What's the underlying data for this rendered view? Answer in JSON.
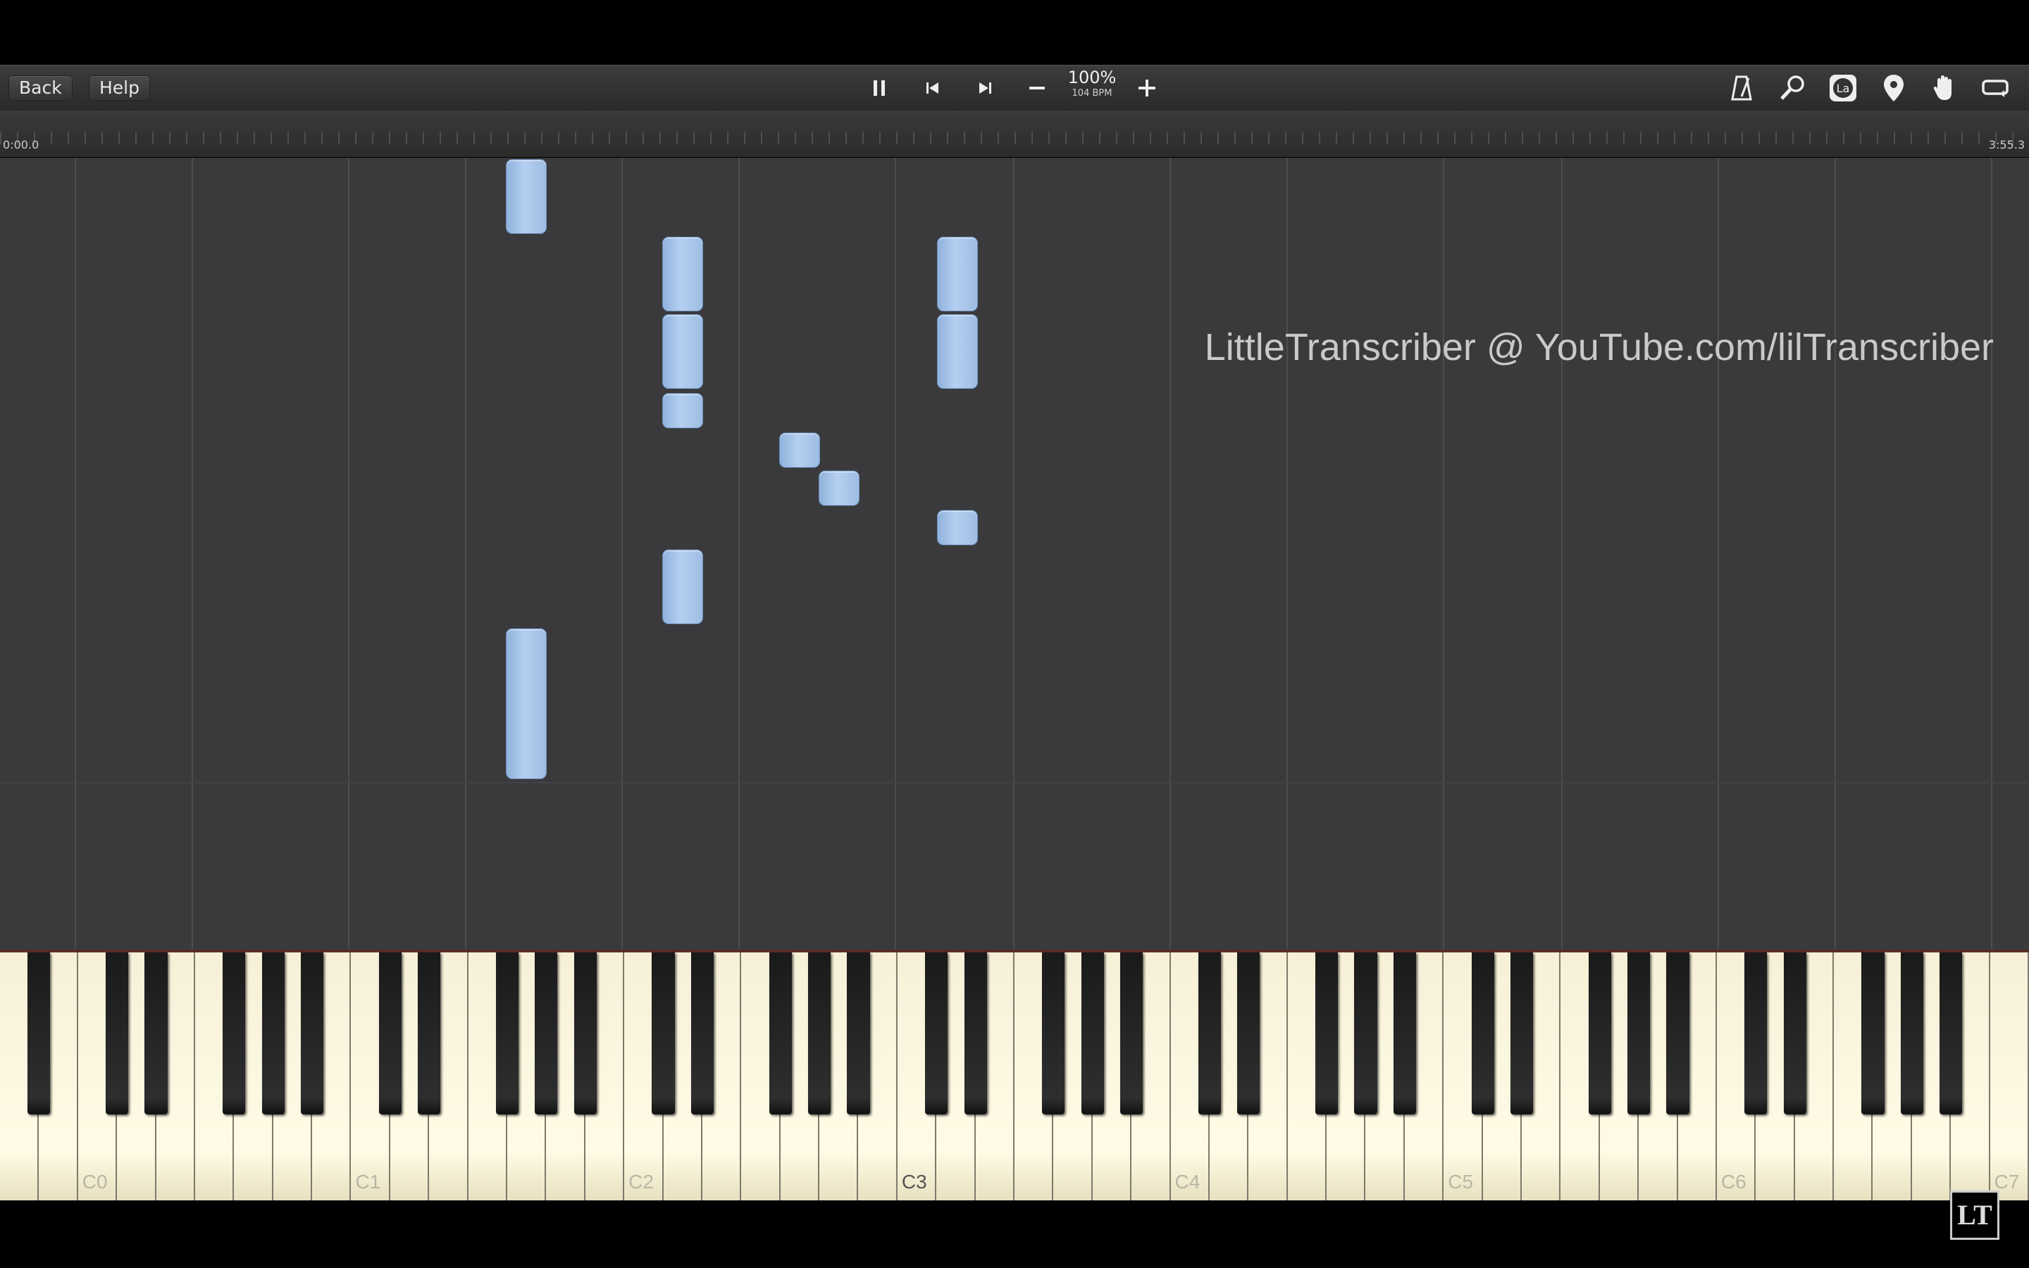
{
  "toolbar": {
    "back_label": "Back",
    "help_label": "Help",
    "speed_percent": "100%",
    "speed_bpm": "104 BPM",
    "icons": [
      "pause-icon",
      "previous-icon",
      "next-icon",
      "minus-icon",
      "plus-icon",
      "metronome-icon",
      "search-icon",
      "la-circle-icon",
      "location-pin-icon",
      "hand-icon",
      "loop-icon"
    ]
  },
  "timeline": {
    "start_time": "0:00.0",
    "end_time": "3:55.3"
  },
  "roll": {
    "watermark": "LittleTranscriber @ YouTube.com/lilTranscriber",
    "note_color": "#a8c4e8"
  },
  "keyboard": {
    "octave_labels": [
      "C0",
      "C1",
      "C2",
      "C3",
      "C4",
      "C5",
      "C6",
      "C7"
    ]
  },
  "corner_logo": "LT"
}
